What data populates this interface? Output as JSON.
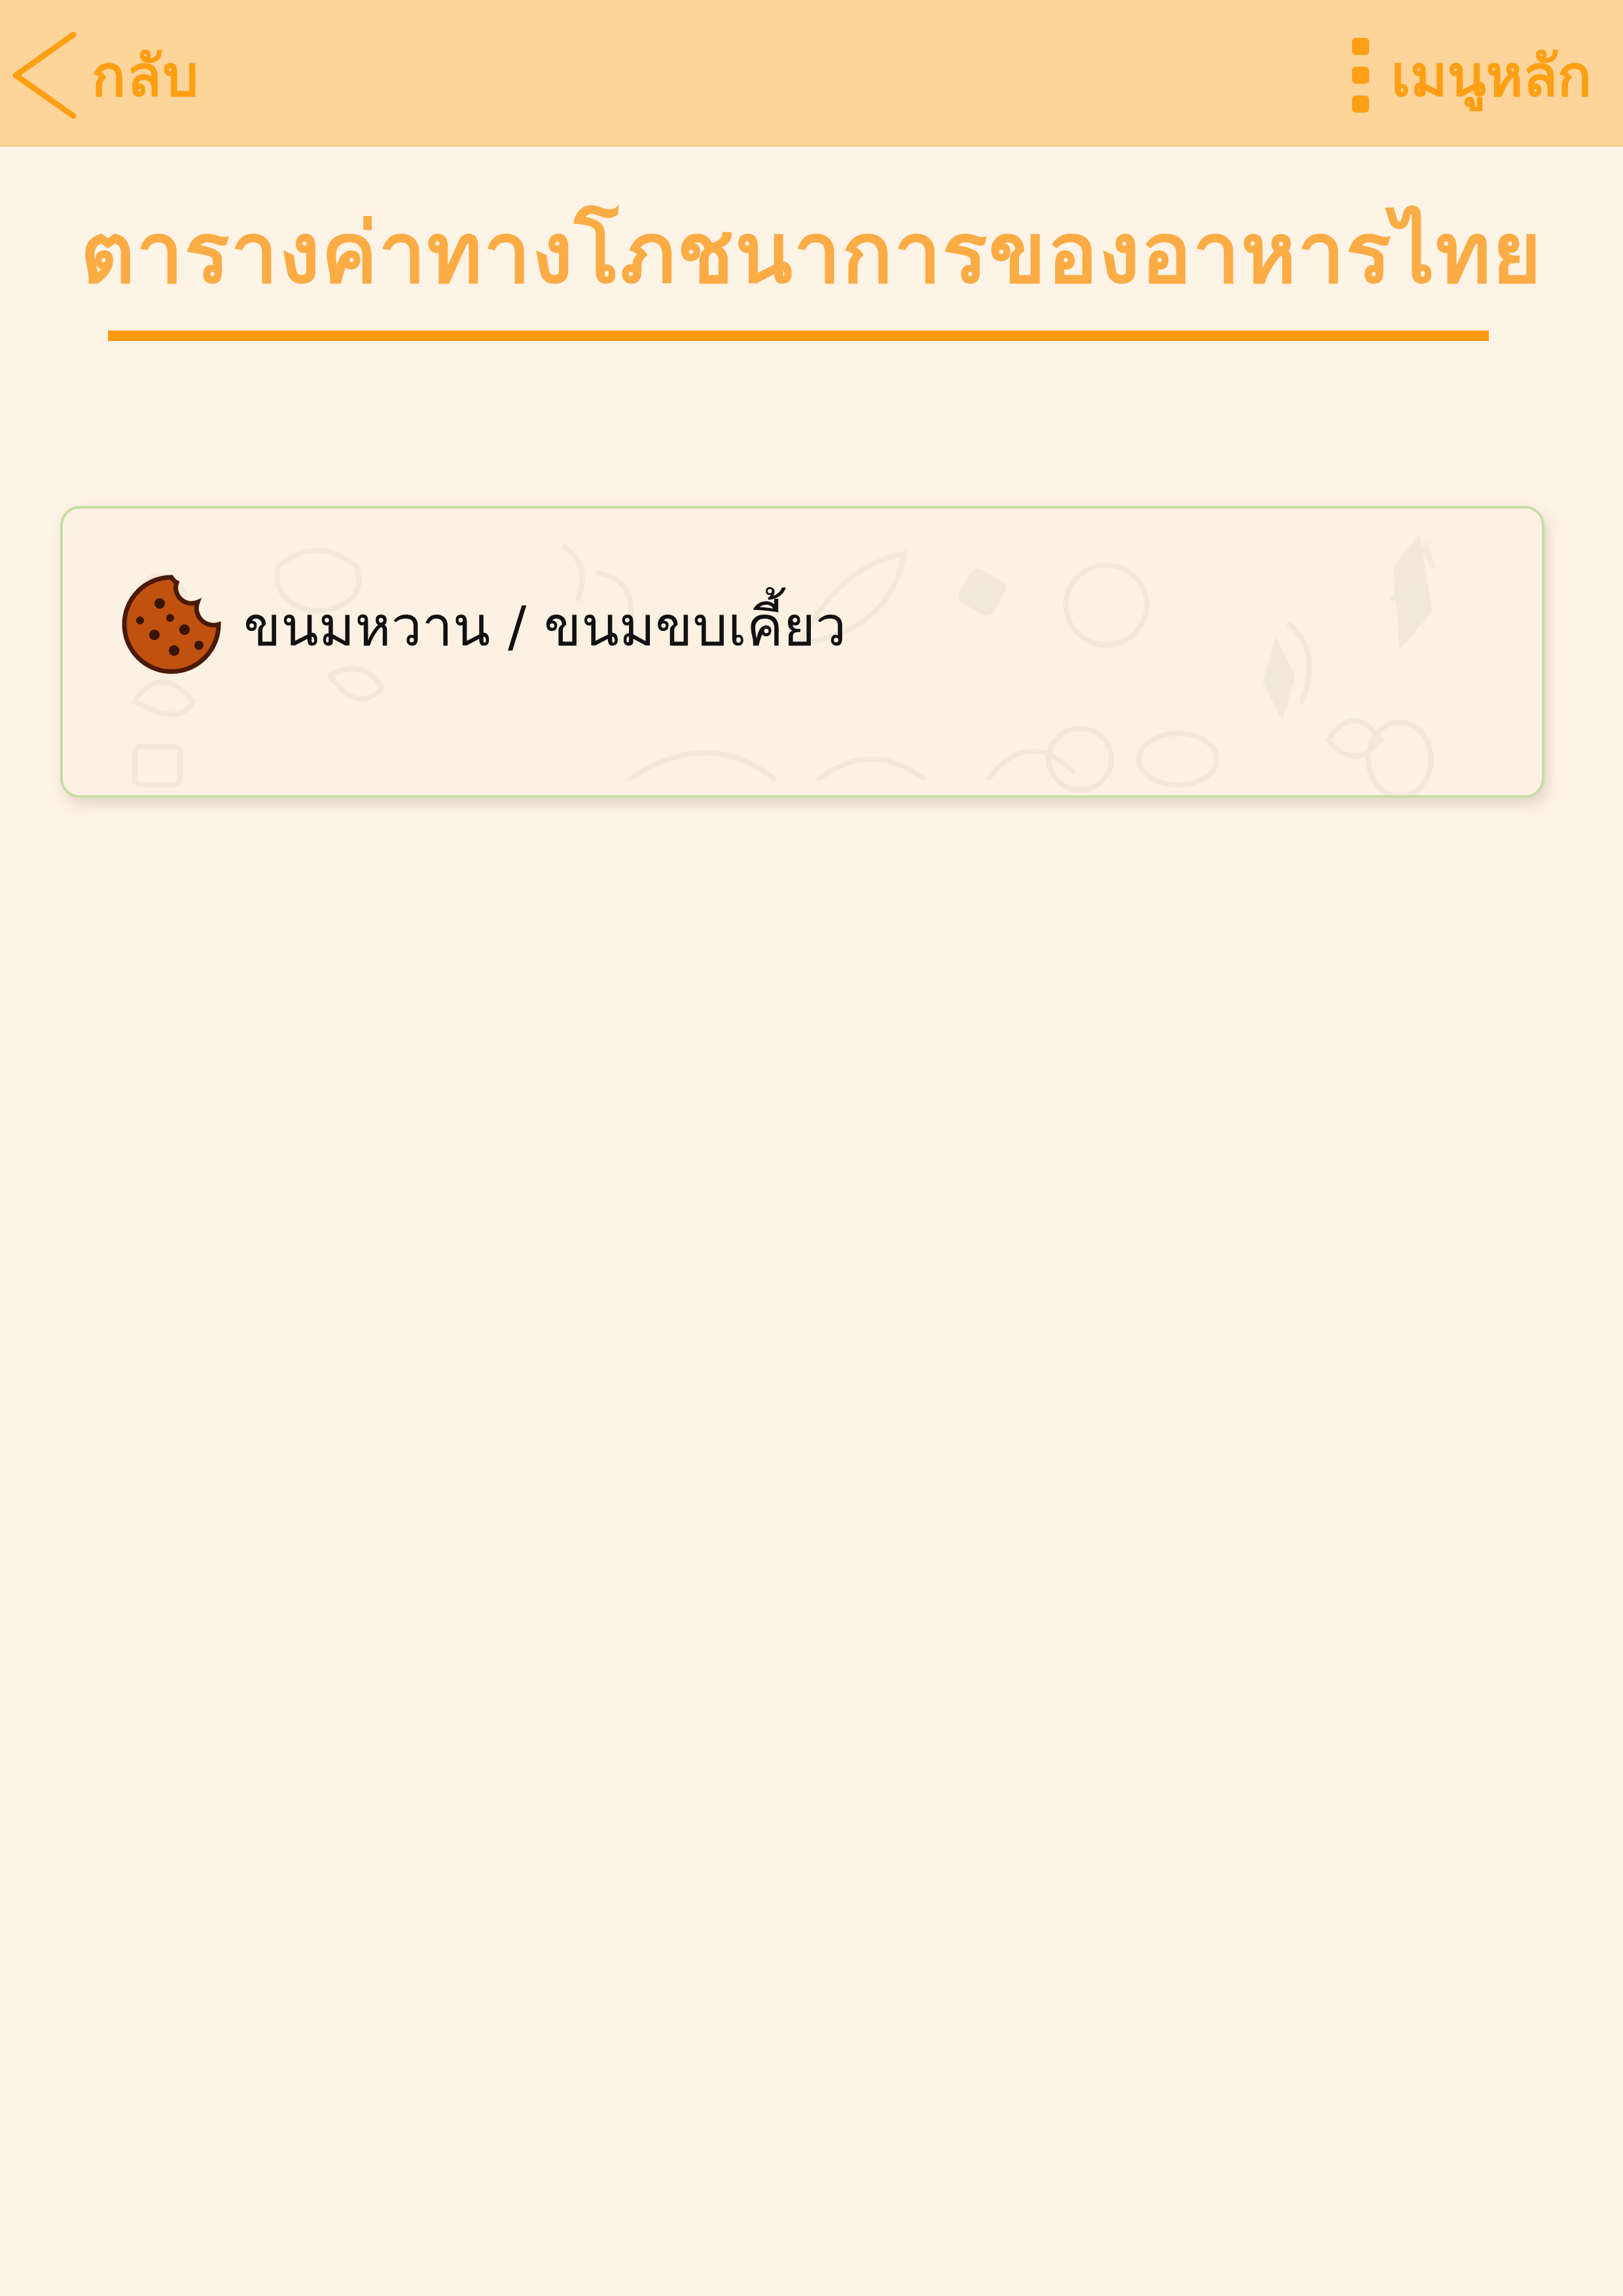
{
  "header": {
    "back_label": "กลับ",
    "menu_label": "เมนูหลัก",
    "back_icon": "chevron-left-icon",
    "menu_icon": "kebab-menu-icon"
  },
  "page": {
    "title": "ตารางค่าทางโภชนาการของอาหารไทย"
  },
  "categories": [
    {
      "label": "ขนมหวาน / ขนมขบเคี้ยว",
      "icon": "cookie-icon"
    }
  ],
  "colors": {
    "accent": "#ff9f14",
    "title": "#fbac45",
    "header_bg": "#fdd49a",
    "page_bg": "#fdf3e6",
    "card_border": "#c8dca8",
    "cookie": "#c0510f"
  }
}
